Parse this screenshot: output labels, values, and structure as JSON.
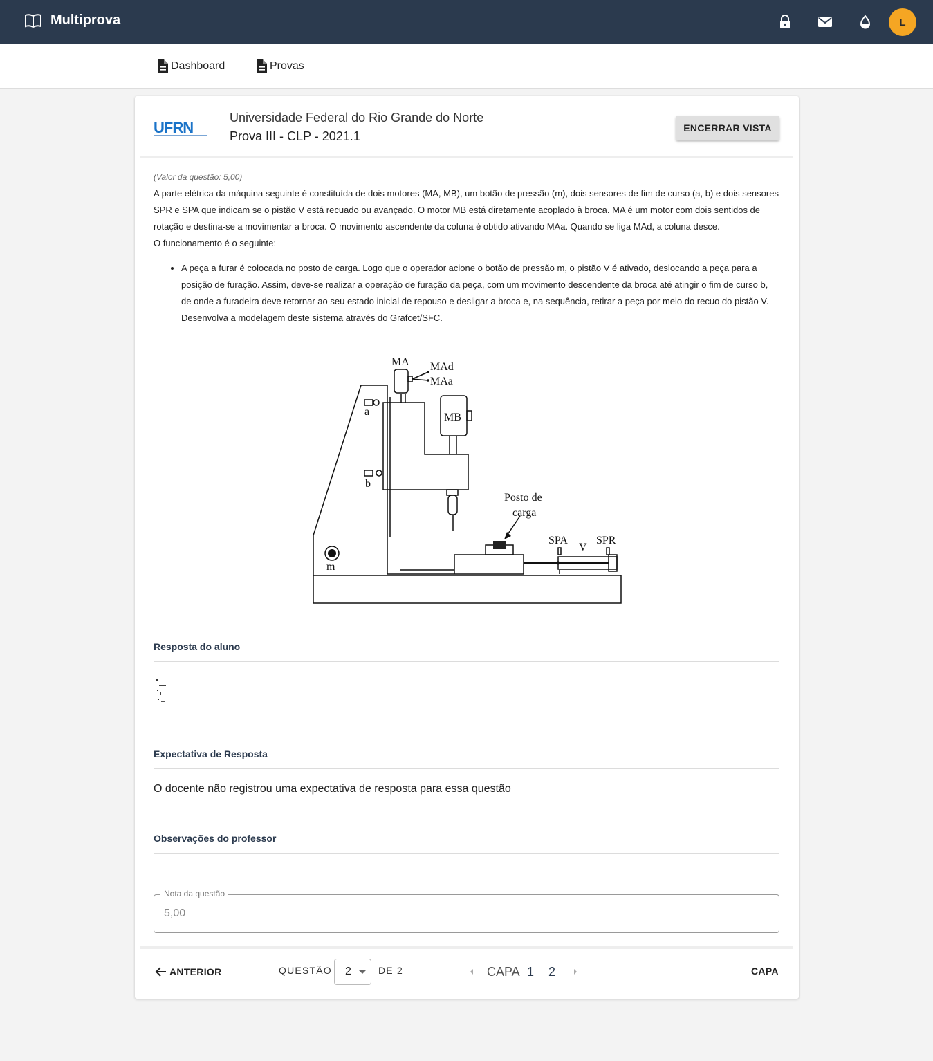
{
  "app": {
    "title": "Multiprova",
    "avatar_initial": "L",
    "accent": "#f5a623",
    "header_bg": "#2b3a4e"
  },
  "header_icons": [
    "book-icon",
    "lock-icon",
    "mail-icon",
    "theme-drop-icon"
  ],
  "nav": {
    "items": [
      {
        "label": "Dashboard",
        "icon": "document-icon"
      },
      {
        "label": "Provas",
        "icon": "document-icon"
      }
    ]
  },
  "exam": {
    "logo_text": "UFRN",
    "university": "Universidade Federal do Rio Grande do Norte",
    "name": "Prova III - CLP - 2021.1",
    "end_button": "ENCERRAR VISTA"
  },
  "question": {
    "value": "(Valor da questão: 5,00)",
    "statement": "A parte elétrica da máquina seguinte é constituída de dois motores (MA, MB), um botão de pressão (m), dois sensores de fim de curso (a,  b) e dois sensores SPR e SPA que indicam se o pistão V está recuado ou avançado. O motor MB está diretamente acoplado à broca. MA é um motor com dois sentidos de rotação e destina-se a movimentar a broca. O movimento ascendente da coluna é obtido ativando MAa. Quando se liga MAd, a coluna desce.",
    "operation_intro": "O funcionamento é o seguinte:",
    "bullet": "A peça a furar é colocada no posto de carga. Logo que o operador acione o botão de pressão m, o pistão V é ativado, deslocando a peça para a posição de furação. Assim, deve-se realizar a operação de furação da peça, com um movimento descendente da broca até atingir o fim de curso b, de onde a furadeira deve retornar ao seu estado inicial de repouso e desligar a broca e, na sequência, retirar a peça por meio do recuo do pistão V. Desenvolva a modelagem deste sistema através do Grafcet/SFC.",
    "figure_labels": {
      "ma": "MA",
      "mad": "MAd",
      "maa": "MAa",
      "mb": "MB",
      "a": "a",
      "b": "b",
      "m": "m",
      "posto": "Posto de",
      "carga": "carga",
      "spa": "SPA",
      "v": "V",
      "spr": "SPR"
    }
  },
  "sections": {
    "student_answer": "Resposta do aluno",
    "expected_title": "Expectativa de Resposta",
    "expected_text": "O docente não registrou uma expectativa de resposta para essa questão",
    "observations": "Observações do professor",
    "grade_label": "Nota da questão",
    "grade_value": "5,00"
  },
  "footer": {
    "prev": "ANTERIOR",
    "question_label": "QUESTÃO",
    "question_selected": "2",
    "of_label": "DE 2",
    "pages": [
      "CAPA",
      "1",
      "2"
    ],
    "cover": "CAPA"
  }
}
